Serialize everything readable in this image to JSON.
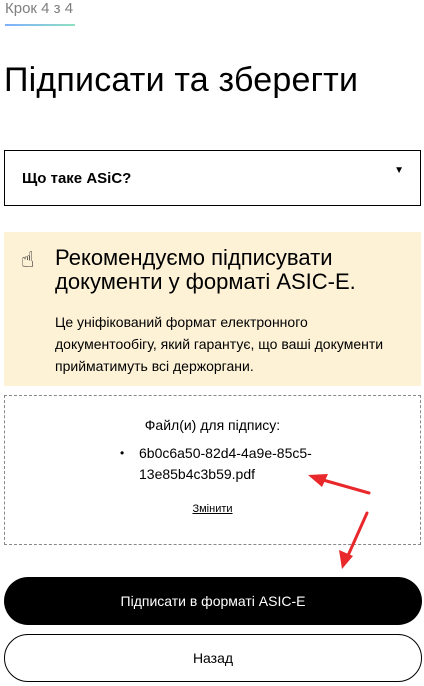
{
  "step": {
    "label": "Крок 4 з 4"
  },
  "page": {
    "title": "Підписати та зберегти"
  },
  "accordion": {
    "label": "Що таке ASiC?",
    "arrow_icon": "triangle-down-icon"
  },
  "recommendation": {
    "icon": "pointing-finger-icon",
    "heading": "Рекомендуємо підписувати документи у форматі ASIC-E.",
    "text": "Це уніфікований формат електронного документообігу, який гарантує, що ваші документи прийматимуть всі держоргани."
  },
  "files": {
    "label": "Файл(и) для підпису:",
    "items": [
      "6b0c6a50-82d4-4a9e-85c5-13e85b4c3b59.pdf"
    ],
    "change_label": "Змінити"
  },
  "actions": {
    "sign_label": "Підписати в форматі ASIC-E",
    "back_label": "Назад"
  },
  "colors": {
    "recommend_bg": "#fdf1d6",
    "annotation_arrow": "#e8282b",
    "primary_button": "#000000"
  }
}
